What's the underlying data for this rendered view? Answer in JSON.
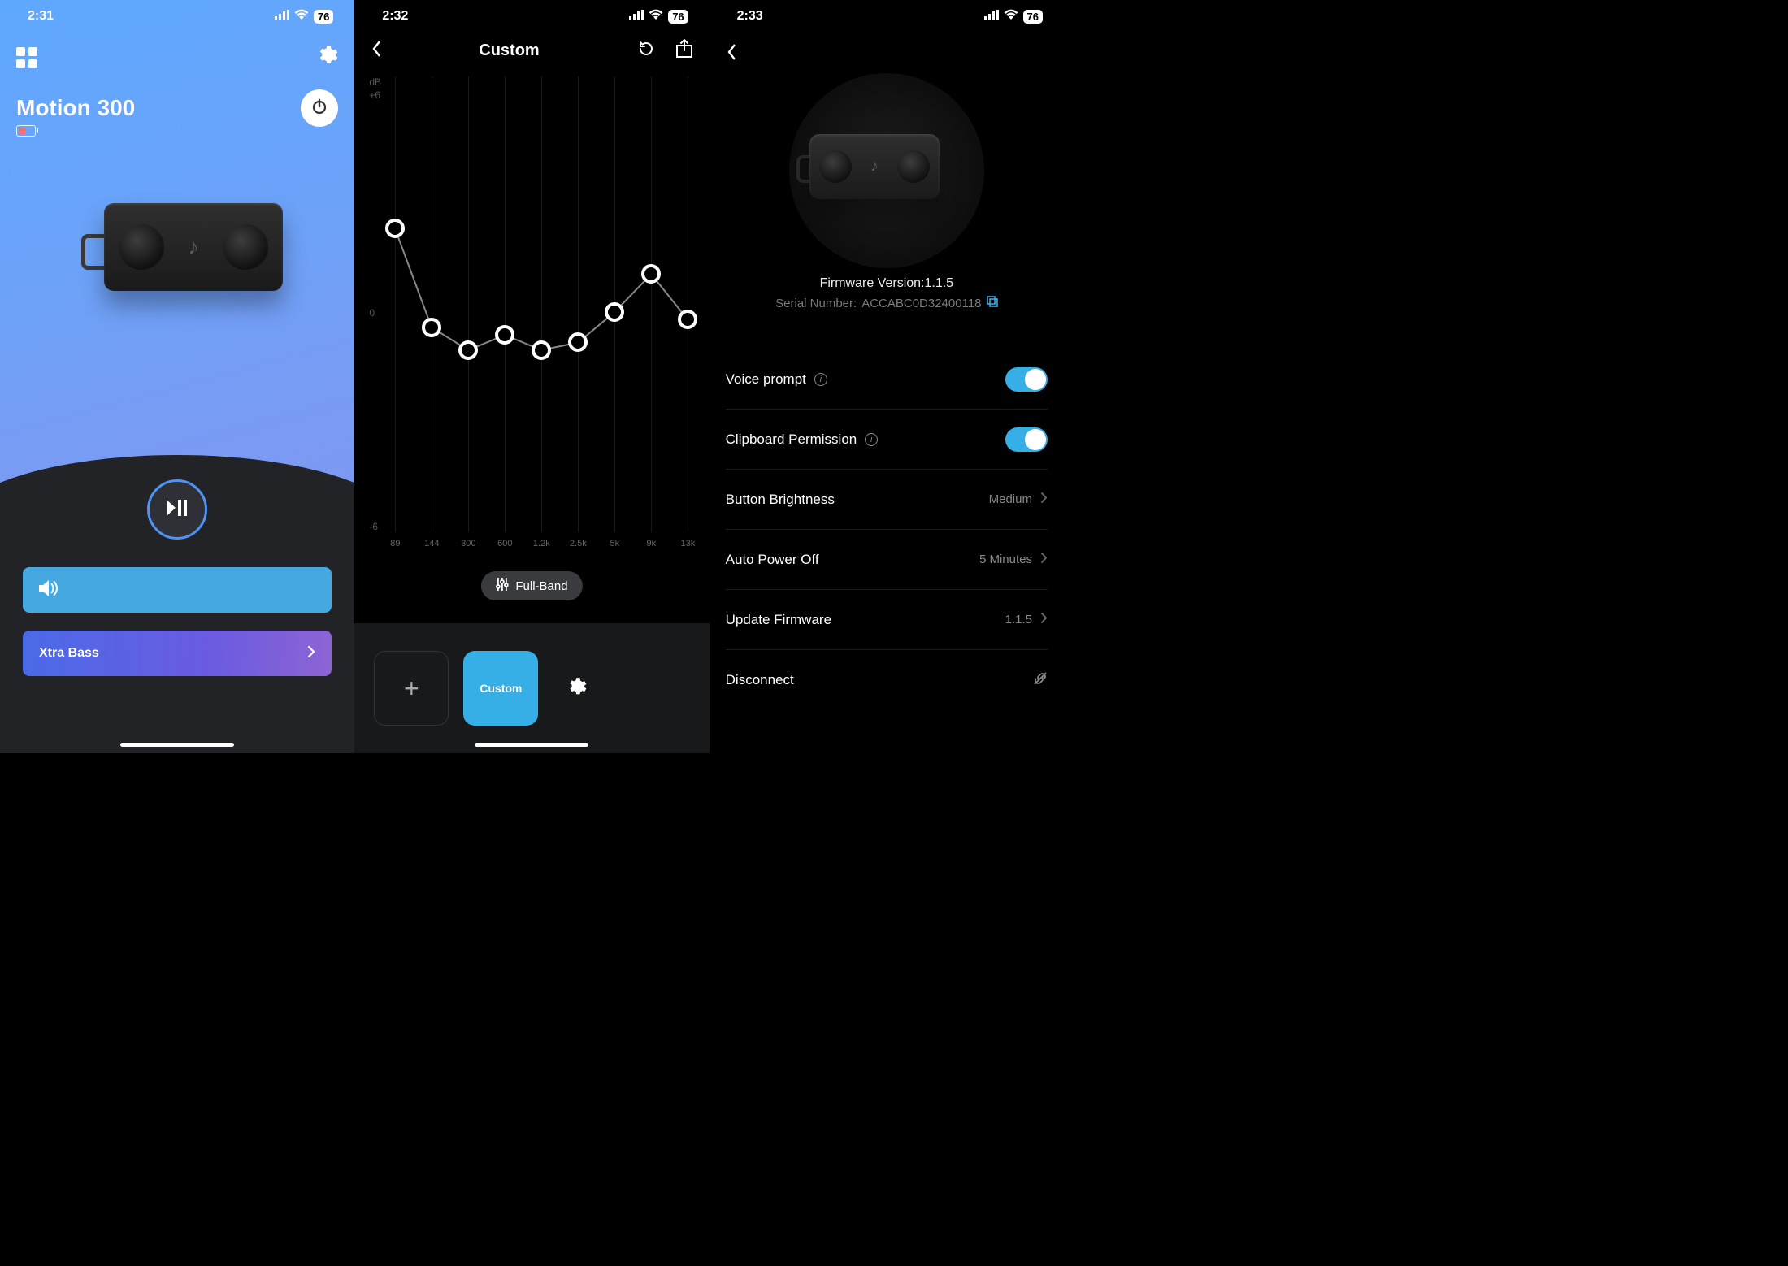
{
  "status": {
    "times": [
      "2:31",
      "2:32",
      "2:33"
    ],
    "battery": "76"
  },
  "screen1": {
    "title": "Motion 300",
    "xtra_label": "Xtra Bass"
  },
  "screen2": {
    "title": "Custom",
    "fullband": "Full-Band",
    "dbLabel": "dB",
    "yTop": "+6",
    "yMid": "0",
    "yBot": "-6",
    "preset_label": "Custom"
  },
  "screen3": {
    "fw_label": "Firmware Version:",
    "fw_value": "1.1.5",
    "serial_label": "Serial Number:",
    "serial_value": "ACCABC0D32400118",
    "rows": {
      "voice": "Voice prompt",
      "clip": "Clipboard Permission",
      "bright": "Button Brightness",
      "bright_val": "Medium",
      "auto": "Auto Power Off",
      "auto_val": "5 Minutes",
      "update": "Update Firmware",
      "update_val": "1.1.5",
      "disconnect": "Disconnect"
    }
  },
  "chart_data": {
    "type": "line",
    "title": "Custom",
    "ylabel": "dB",
    "xlabel": "",
    "ylim": [
      -6,
      6
    ],
    "categories": [
      "89",
      "144",
      "300",
      "600",
      "1.2k",
      "2.5k",
      "5k",
      "9k",
      "13k"
    ],
    "values": [
      2.0,
      -0.6,
      -1.2,
      -0.8,
      -1.2,
      -1.0,
      -0.2,
      0.8,
      -0.4
    ]
  }
}
